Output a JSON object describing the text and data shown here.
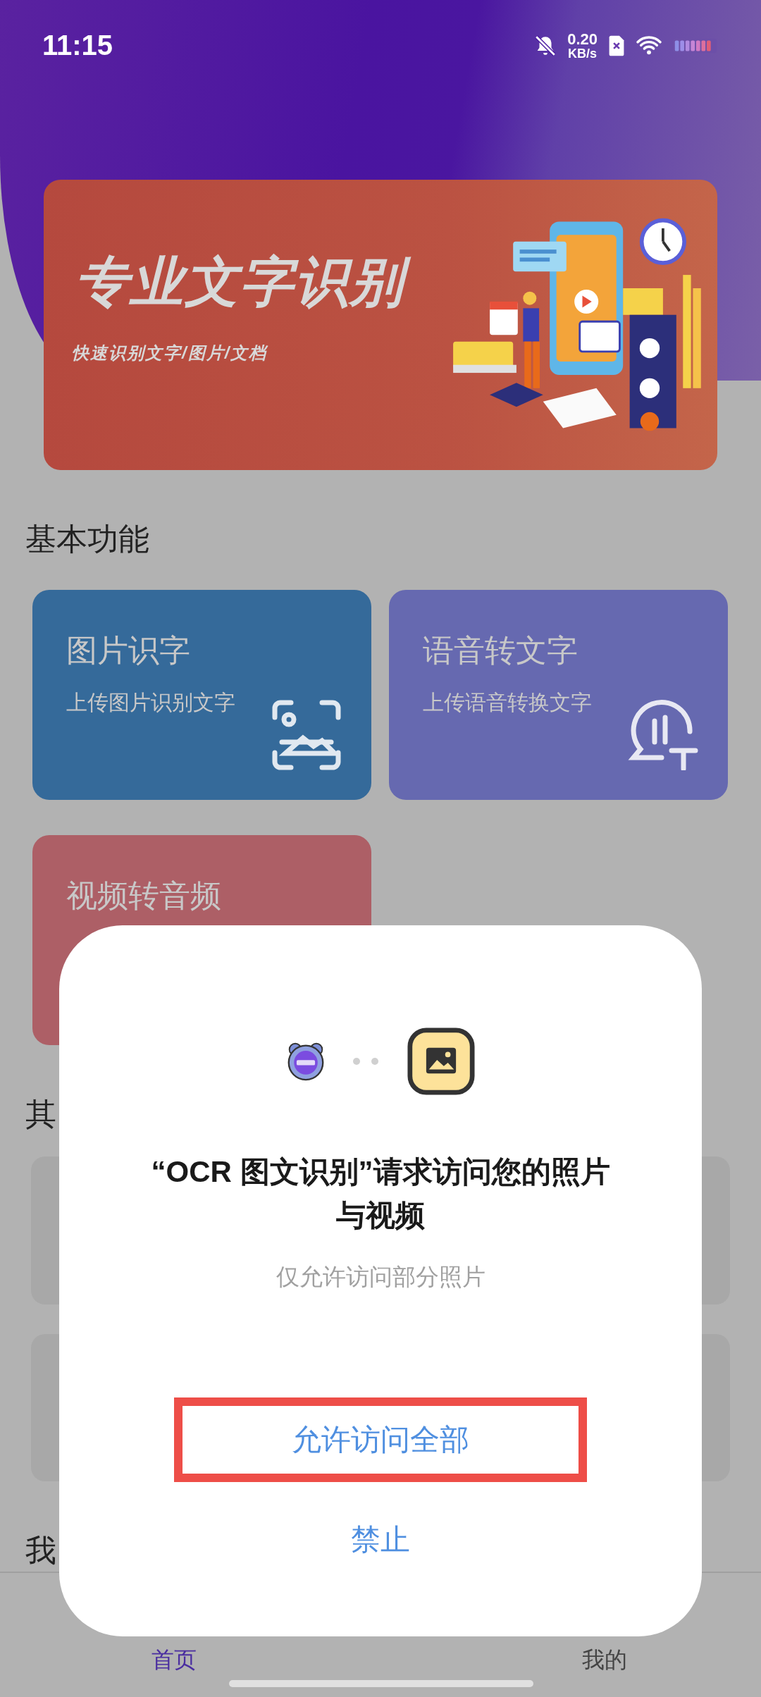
{
  "status_bar": {
    "time": "11:15",
    "speed_value": "0.20",
    "speed_unit": "KB/s"
  },
  "banner": {
    "title": "专业文字识别",
    "subtitle": "快速识别文字/图片/文档"
  },
  "sections": [
    {
      "title": "基本功能",
      "cards": [
        {
          "title": "图片识字",
          "subtitle": "上传图片识别文字",
          "kind": "image-scan",
          "color": "#356a9a"
        },
        {
          "title": "语音转文字",
          "subtitle": "上传语音转换文字",
          "kind": "voice-text",
          "color": "#6669b0"
        },
        {
          "title": "视频转音频",
          "kind": "plain",
          "color": "#ad5f66"
        }
      ]
    },
    {
      "title": "其",
      "kind": "placeholders"
    },
    {
      "title": "我",
      "kind": "heading"
    }
  ],
  "bottom_nav": [
    {
      "label": "首页",
      "selected": true
    },
    {
      "label": "我的",
      "selected": false
    }
  ],
  "dialog": {
    "title": "“OCR 图文识别”请求访问您的照片与视频",
    "subtitle": "仅允许访问部分照片",
    "buttons": [
      {
        "label": "允许访问全部",
        "highlighted": true
      },
      {
        "label": "禁止",
        "highlighted": false
      }
    ]
  }
}
